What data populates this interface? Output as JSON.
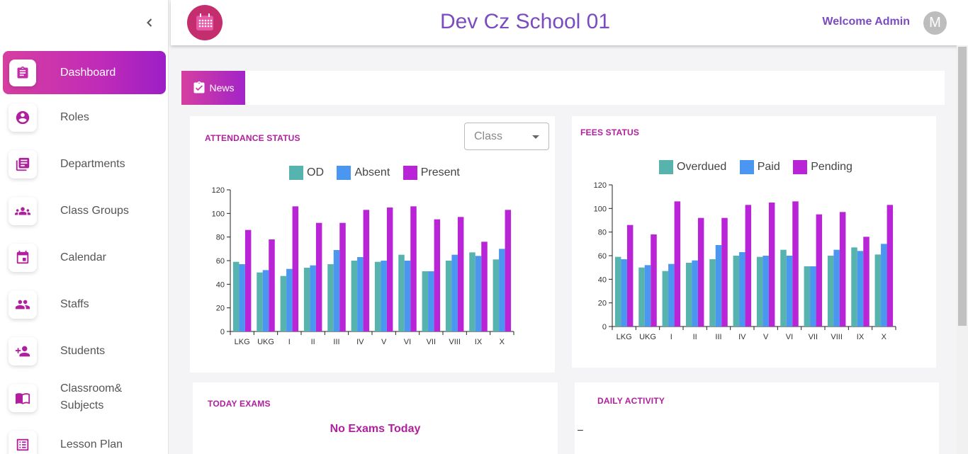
{
  "sidebar": {
    "items": [
      {
        "label": "Dashboard",
        "icon": "clipboard-icon",
        "active": true
      },
      {
        "label": "Roles",
        "icon": "account-circle-icon"
      },
      {
        "label": "Departments",
        "icon": "library-books-icon"
      },
      {
        "label": "Class Groups",
        "icon": "groups-icon"
      },
      {
        "label": "Calendar",
        "icon": "calendar-icon"
      },
      {
        "label": "Staffs",
        "icon": "people-icon"
      },
      {
        "label": "Students",
        "icon": "person-add-icon"
      },
      {
        "label": "Classroom&",
        "label2": "Subjects",
        "icon": "book-icon"
      },
      {
        "label": "Lesson Plan",
        "icon": "list-alt-icon"
      }
    ]
  },
  "header": {
    "title": "Dev Cz School 01",
    "welcome": "Welcome Admin",
    "avatar_letter": "M"
  },
  "news": {
    "tab_label": "News"
  },
  "attendance": {
    "title": "ATTENDANCE STATUS",
    "class_select": {
      "value": "Class"
    }
  },
  "fees": {
    "title": "FEES STATUS"
  },
  "exams": {
    "title": "TODAY EXAMS",
    "empty_text": "No Exams Today"
  },
  "daily": {
    "title": "DAILY ACTIVITY",
    "dash": "–"
  },
  "colors": {
    "series1": "#56b3ae",
    "series2": "#4b96f0",
    "series3": "#b924d6",
    "accent": "#b0209e",
    "brand": "#7a4cc0"
  },
  "chart_data": [
    {
      "type": "bar",
      "title": "ATTENDANCE STATUS",
      "categories": [
        "LKG",
        "UKG",
        "I",
        "II",
        "III",
        "IV",
        "V",
        "VI",
        "VII",
        "VIII",
        "IX",
        "X"
      ],
      "ylim": [
        0,
        120
      ],
      "yticks": [
        0,
        20,
        40,
        60,
        80,
        100,
        120
      ],
      "legend_position": "top-center",
      "grid": false,
      "series": [
        {
          "name": "OD",
          "color": "#56b3ae",
          "values": [
            59,
            50,
            47,
            54,
            57,
            60,
            59,
            65,
            51,
            60,
            67,
            61
          ]
        },
        {
          "name": "Absent",
          "color": "#4b96f0",
          "values": [
            57,
            52,
            53,
            56,
            69,
            63,
            60,
            60,
            51,
            65,
            64,
            70
          ]
        },
        {
          "name": "Present",
          "color": "#b924d6",
          "values": [
            86,
            78,
            106,
            92,
            92,
            103,
            105,
            106,
            95,
            97,
            76,
            103
          ]
        }
      ]
    },
    {
      "type": "bar",
      "title": "FEES STATUS",
      "categories": [
        "LKG",
        "UKG",
        "I",
        "II",
        "III",
        "IV",
        "V",
        "VI",
        "VII",
        "VIII",
        "IX",
        "X"
      ],
      "ylim": [
        0,
        120
      ],
      "yticks": [
        0,
        20,
        40,
        60,
        80,
        100,
        120
      ],
      "legend_position": "top-center",
      "grid": false,
      "series": [
        {
          "name": "Overdued",
          "color": "#56b3ae",
          "values": [
            59,
            50,
            47,
            54,
            57,
            60,
            59,
            65,
            51,
            60,
            67,
            61
          ]
        },
        {
          "name": "Paid",
          "color": "#4b96f0",
          "values": [
            57,
            52,
            53,
            56,
            69,
            63,
            60,
            60,
            51,
            65,
            64,
            70
          ]
        },
        {
          "name": "Pending",
          "color": "#b924d6",
          "values": [
            86,
            78,
            106,
            92,
            92,
            103,
            105,
            106,
            95,
            97,
            76,
            103
          ]
        }
      ]
    }
  ]
}
